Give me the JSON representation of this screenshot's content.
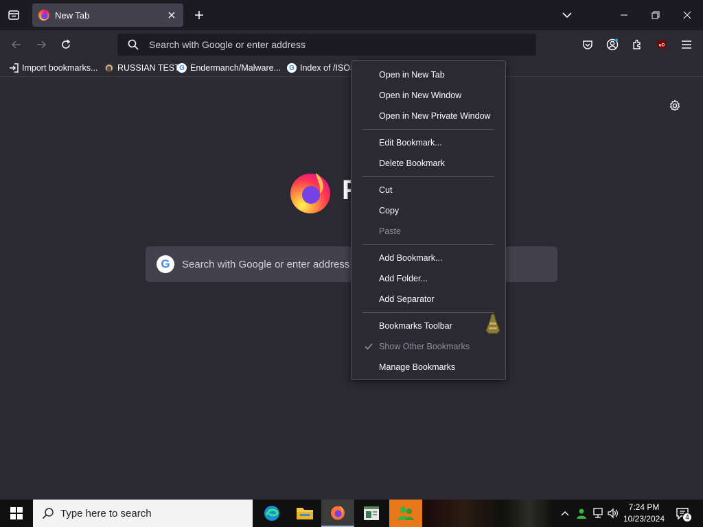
{
  "tabs": [
    {
      "title": "New Tab"
    }
  ],
  "urlbar": {
    "placeholder": "Search with Google or enter address"
  },
  "bookmarks": [
    {
      "label": "Import bookmarks...",
      "icon": "import-icon"
    },
    {
      "label": "RUSSIAN TEST",
      "icon": "github-icon"
    },
    {
      "label": "Endermanch/Malware...",
      "icon": "google-icon"
    },
    {
      "label": "Index of /ISOs",
      "icon": "google-icon"
    }
  ],
  "newtab": {
    "wordmark": "F",
    "search_placeholder": "Search with Google or enter address"
  },
  "context_menu": {
    "items": [
      {
        "label": "Open in New Tab"
      },
      {
        "label": "Open in New Window"
      },
      {
        "label": "Open in New Private Window"
      },
      {
        "label": "Edit Bookmark..."
      },
      {
        "label": "Delete Bookmark"
      },
      {
        "label": "Cut"
      },
      {
        "label": "Copy"
      },
      {
        "label": "Paste",
        "disabled": true
      },
      {
        "label": "Add Bookmark..."
      },
      {
        "label": "Add Folder..."
      },
      {
        "label": "Add Separator"
      },
      {
        "label": "Bookmarks Toolbar"
      },
      {
        "label": "Show Other Bookmarks",
        "checked": true,
        "disabled": true
      },
      {
        "label": "Manage Bookmarks"
      }
    ]
  },
  "taskbar": {
    "search_placeholder": "Type here to search",
    "apps": [
      "edge-icon",
      "file-explorer-icon",
      "firefox-icon",
      "app-icon",
      "green-app-icon"
    ],
    "time": "7:24 PM",
    "date": "10/23/2024",
    "notification_count": "4"
  },
  "colors": {
    "chrome": "#1c1b22",
    "toolbar": "#2b2a33",
    "tab_selected": "#42414d",
    "text": "#fbfbfe"
  }
}
